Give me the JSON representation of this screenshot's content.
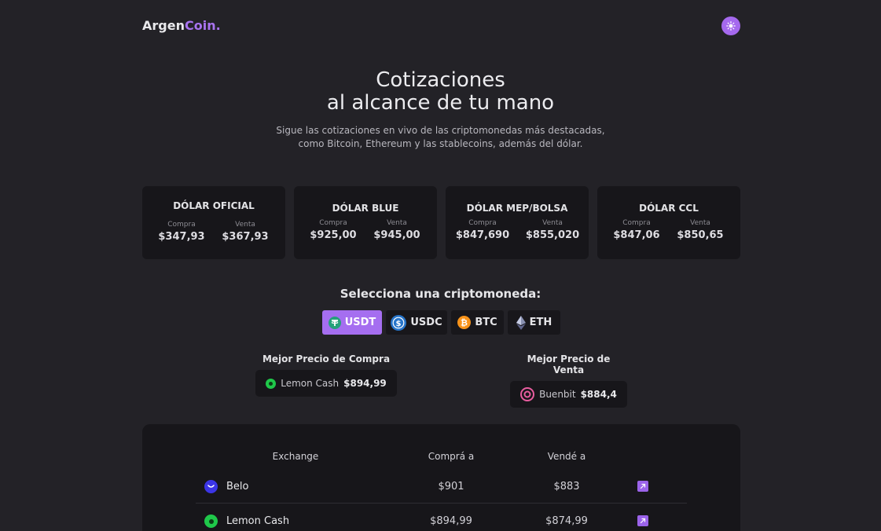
{
  "brand": {
    "name_part1": "Argen",
    "name_part2": "Coin."
  },
  "header": {
    "theme_toggle_icon": "sun-icon"
  },
  "hero": {
    "title_line1": "Cotizaciones",
    "title_line2": "al alcance de tu mano",
    "subtitle_line1": "Sigue las cotizaciones en vivo de las criptomonedas más destacadas,",
    "subtitle_line2": "como Bitcoin, Ethereum y las stablecoins, además del dólar."
  },
  "dollar_cards": [
    {
      "title": "DÓLAR OFICIAL",
      "buy_label": "Compra",
      "buy": "$347,93",
      "sell_label": "Venta",
      "sell": "$367,93"
    },
    {
      "title": "DÓLAR BLUE",
      "buy_label": "Compra",
      "buy": "$925,00",
      "sell_label": "Venta",
      "sell": "$945,00"
    },
    {
      "title": "DÓLAR MEP/BOLSA",
      "buy_label": "Compra",
      "buy": "$847,690",
      "sell_label": "Venta",
      "sell": "$855,020"
    },
    {
      "title": "DÓLAR CCL",
      "buy_label": "Compra",
      "buy": "$847,06",
      "sell_label": "Venta",
      "sell": "$850,65"
    }
  ],
  "crypto_selector": {
    "title": "Selecciona una criptomoneda:",
    "options": [
      {
        "label": "USDT",
        "icon": "tether-icon",
        "color": "#26a17b",
        "active": true
      },
      {
        "label": "USDC",
        "icon": "usdc-icon",
        "color": "#2775ca",
        "active": false
      },
      {
        "label": "BTC",
        "icon": "bitcoin-icon",
        "color": "#f7931a",
        "active": false
      },
      {
        "label": "ETH",
        "icon": "ethereum-icon",
        "color": "#8a92b2",
        "active": false
      }
    ]
  },
  "best_prices": {
    "buy": {
      "label": "Mejor Precio de Compra",
      "exchange": "Lemon Cash",
      "price": "$894,99"
    },
    "sell": {
      "label": "Mejor Precio de Venta",
      "exchange": "Buenbit",
      "price": "$884,4"
    }
  },
  "table": {
    "headers": {
      "exchange": "Exchange",
      "buy": "Comprá a",
      "sell": "Vendé a"
    },
    "rows": [
      {
        "exchange": "Belo",
        "icon": "belo-icon",
        "buy": "$901",
        "sell": "$883"
      },
      {
        "exchange": "Lemon Cash",
        "icon": "lemon-cash-icon",
        "buy": "$894,99",
        "sell": "$874,99"
      }
    ]
  },
  "colors": {
    "accent": "#a56ef0",
    "background": "#232227",
    "card": "#17161a"
  }
}
